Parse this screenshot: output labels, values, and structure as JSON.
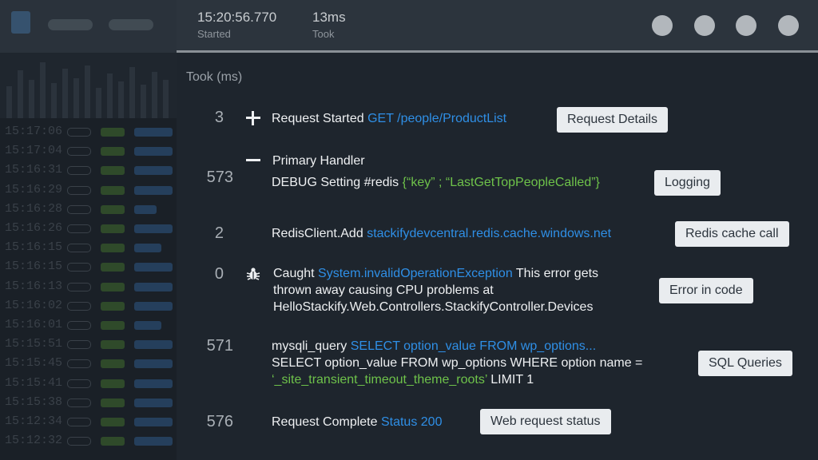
{
  "header": {
    "started_value": "15:20:56.770",
    "started_label": "Started",
    "took_value": "13ms",
    "took_label": "Took"
  },
  "sidebar": {
    "times": [
      "15:17:06",
      "15:17:04",
      "15:16:31",
      "15:16:29",
      "15:16:28",
      "15:16:26",
      "15:16:15",
      "15:16:15",
      "15:16:13",
      "15:16:02",
      "15:16:01",
      "15:15:51",
      "15:15:45",
      "15:15:41",
      "15:15:38",
      "15:12:34",
      "15:12:32"
    ]
  },
  "main": {
    "section_title": "Took (ms)",
    "rows": [
      {
        "took": "3",
        "label": "Request Started",
        "detail": "GET /people/ProductList",
        "tag": "Request Details"
      },
      {
        "took": "573",
        "heading": "Primary Handler",
        "label": "DEBUG Setting #redis",
        "detail": "{“key” ; “LastGetTopPeopleCalled”}",
        "tag": "Logging"
      },
      {
        "took": "2",
        "label": "RedisClient.Add",
        "detail": "stackifydevcentral.redis.cache.windows.net",
        "tag": "Redis cache call"
      },
      {
        "took": "0",
        "label": "Caught",
        "detail": "System.invalidOperationException",
        "text_a": "This error gets",
        "text_b": "thrown away causing CPU problems at",
        "text_c": "HelloStackify.Web.Controllers.StackifyController.Devices",
        "tag": "Error in code"
      },
      {
        "took": "571",
        "label": "mysqli_query",
        "detail": "SELECT option_value FROM wp_options...",
        "text_a": "SELECT option_value FROM wp_options WHERE option name =",
        "detail2": "‘_site_transient_timeout_theme_roots’",
        "text_b": "LIMIT 1",
        "tag": "SQL Queries"
      },
      {
        "took": "576",
        "label": "Request Complete",
        "detail": "Status 200",
        "tag": "Web request status"
      }
    ]
  }
}
